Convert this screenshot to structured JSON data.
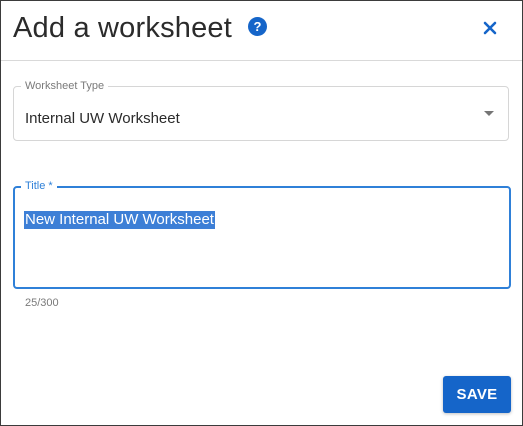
{
  "dialog": {
    "title": "Add a worksheet",
    "help_icon": "help-circle-icon",
    "close_icon": "close-icon"
  },
  "worksheet_type": {
    "label": "Worksheet Type",
    "value": "Internal UW Worksheet",
    "caret_icon": "dropdown-caret-icon"
  },
  "title_field": {
    "label": "Title *",
    "value": "New Internal UW Worksheet",
    "char_count": "25/300"
  },
  "actions": {
    "save_label": "SAVE"
  },
  "colors": {
    "accent": "#1565c9",
    "focus_border": "#2f80d8",
    "selection": "#3d7fd6"
  }
}
